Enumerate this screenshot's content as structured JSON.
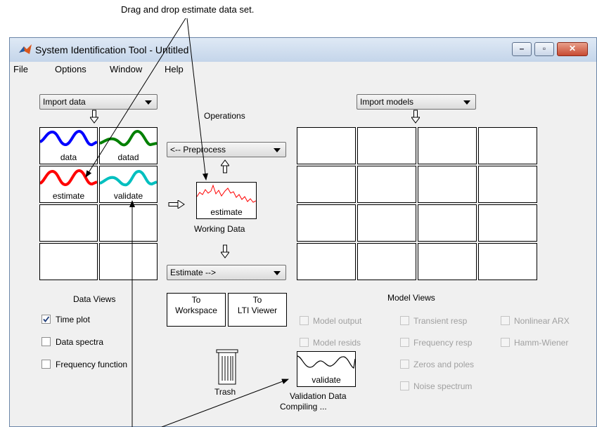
{
  "annotations": {
    "top": "Drag and drop estimate data set."
  },
  "window": {
    "title": "System Identification Tool - Untitled",
    "controls": {
      "minimize": "–",
      "maximize": "▫",
      "close": "✕"
    }
  },
  "menu": [
    "File",
    "Options",
    "Window",
    "Help"
  ],
  "data_panel": {
    "import_dropdown": "Import data",
    "tiles": [
      {
        "label": "data",
        "color": "#0000ff"
      },
      {
        "label": "datad",
        "color": "#008000"
      },
      {
        "label": "estimate",
        "color": "#ff0000"
      },
      {
        "label": "validate",
        "color": "#00bfbf"
      }
    ],
    "views_title": "Data Views",
    "views": [
      {
        "label": "Time plot",
        "checked": true
      },
      {
        "label": "Data spectra",
        "checked": false
      },
      {
        "label": "Frequency function",
        "checked": false
      }
    ]
  },
  "operations": {
    "title": "Operations",
    "preprocess_dropdown": "<-- Preprocess",
    "working_data_tile": "estimate",
    "working_data_caption": "Working Data",
    "estimate_dropdown": "Estimate -->",
    "to_workspace": [
      "To",
      "Workspace"
    ],
    "to_lti_viewer": [
      "To",
      "LTI Viewer"
    ],
    "trash_label": "Trash",
    "validation_tile": "validate",
    "validation_caption": "Validation Data",
    "compiling": "Compiling ..."
  },
  "model_panel": {
    "import_dropdown": "Import models",
    "views_title": "Model Views",
    "views_col1": [
      "Model output",
      "Model resids"
    ],
    "views_col2": [
      "Transient resp",
      "Frequency resp",
      "Zeros and poles",
      "Noise spectrum"
    ],
    "views_col3": [
      "Nonlinear ARX",
      "Hamm-Wiener"
    ]
  }
}
